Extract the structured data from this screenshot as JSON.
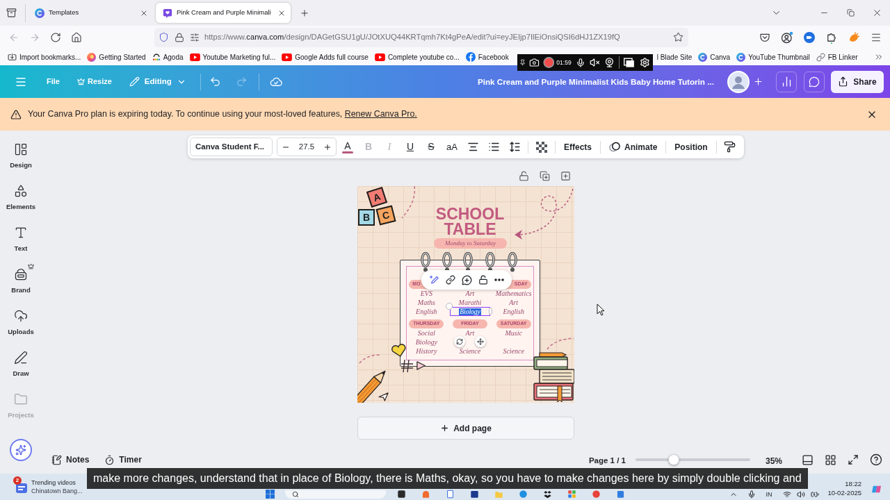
{
  "browser": {
    "tabs": [
      {
        "title": "Templates",
        "kind": "canva",
        "selected": false
      },
      {
        "title": "Pink Cream and Purple Minimali",
        "kind": "design",
        "selected": true
      }
    ],
    "navigation": [
      {
        "kind": "back",
        "disabled": true
      },
      {
        "kind": "forward",
        "disabled": true
      },
      {
        "kind": "reload",
        "disabled": false
      },
      {
        "kind": "home",
        "disabled": false
      }
    ],
    "url": {
      "prefix": "https://www.",
      "domain": "canva.com",
      "path": "/design/DAGetGSU1gU/JOtXUQ44KRTqmh7Kt4gPeA/edit?ui=eyJEIjp7IlEiOnsiQSI6dHJ1ZX19fQ"
    }
  },
  "bookmarks_bar": {
    "items": [
      {
        "label": "Import bookmarks...",
        "kind": "import"
      },
      {
        "label": "Getting Started",
        "kind": "firefox"
      },
      {
        "label": "Agoda",
        "kind": "agoda"
      },
      {
        "label": "Youtube Marketing ful...",
        "kind": "youtube"
      },
      {
        "label": "Google Adds full course",
        "kind": "youtube"
      },
      {
        "label": "Complete youtube co...",
        "kind": "youtube"
      },
      {
        "label": "Facebook",
        "kind": "facebook"
      }
    ],
    "recorder": {
      "time": "01:59"
    },
    "items_after_recorder": [
      {
        "label": "l Blade Site",
        "kind": "plain"
      },
      {
        "label": "Canva",
        "kind": "canva"
      },
      {
        "label": "YouTube Thumbnail",
        "kind": "canva"
      },
      {
        "label": "FB Linker",
        "kind": "link"
      }
    ]
  },
  "editor_header": {
    "menu": [
      {
        "label": "File",
        "kind": "file"
      },
      {
        "label": "Resize",
        "kind": "resize"
      },
      {
        "label": "Editing",
        "kind": "editing"
      }
    ],
    "history": [
      {
        "kind": "undo",
        "disabled": false
      },
      {
        "kind": "redo",
        "disabled": true
      }
    ],
    "title": "Pink Cream and Purple Minimalist Kids Baby Home Tutorin ...",
    "share": "Share"
  },
  "banner": {
    "message": "Your Canva Pro plan is expiring today. To continue using your most-loved features,",
    "link": "Renew Canva Pro."
  },
  "sidebar": {
    "items": [
      {
        "label": "Design",
        "kind": "design",
        "disabled": false
      },
      {
        "label": "Elements",
        "kind": "elements",
        "disabled": false
      },
      {
        "label": "Text",
        "kind": "text",
        "disabled": false
      },
      {
        "label": "Brand",
        "kind": "brand",
        "disabled": false
      },
      {
        "label": "Uploads",
        "kind": "uploads",
        "disabled": false
      },
      {
        "label": "Draw",
        "kind": "draw",
        "disabled": false
      },
      {
        "label": "Projects",
        "kind": "projects",
        "disabled": true
      }
    ]
  },
  "text_toolbar": {
    "font": "Canva Student F...",
    "size": "27.5",
    "controls": [
      {
        "kind": "color",
        "label": "A",
        "color": "#b4587c",
        "disabled": false
      },
      {
        "kind": "bold",
        "label": "B",
        "disabled": true
      },
      {
        "kind": "italic",
        "label": "I",
        "disabled": true
      },
      {
        "kind": "underline",
        "label": "U",
        "disabled": false
      },
      {
        "kind": "strike",
        "label": "S",
        "disabled": false
      },
      {
        "kind": "case",
        "label": "aA",
        "disabled": false
      },
      {
        "kind": "align",
        "disabled": false
      },
      {
        "kind": "list",
        "disabled": false
      },
      {
        "kind": "spacing",
        "disabled": false
      },
      {
        "kind": "transparency",
        "disabled": false
      }
    ],
    "actions": [
      {
        "kind": "effects",
        "label": "Effects"
      },
      {
        "kind": "animate",
        "label": "Animate"
      },
      {
        "kind": "position",
        "label": "Position"
      },
      {
        "kind": "format_painter"
      }
    ]
  },
  "design": {
    "blocks": [
      {
        "letter": "A",
        "color": "#f07c73"
      },
      {
        "letter": "B",
        "color": "#a3d9e6"
      },
      {
        "letter": "C",
        "color": "#f4a45e"
      }
    ],
    "title": "SCHOOL TABLE",
    "subtitle": "Monday to Saturday",
    "rows": [
      {
        "columns": [
          {
            "day": "MO",
            "subjects": [
              {
                "text": "EVS",
                "selected": false
              },
              {
                "text": "Maths",
                "selected": false
              },
              {
                "text": "English",
                "selected": false
              }
            ]
          },
          {
            "subjects": [
              {
                "text": "Art",
                "selected": false
              },
              {
                "text": "Marathi",
                "selected": false
              },
              {
                "text": "Biology",
                "selected": true
              }
            ]
          },
          {
            "day": "SDAY",
            "subjects": [
              {
                "text": "Mathematics",
                "selected": false
              },
              {
                "text": "Art",
                "selected": false
              },
              {
                "text": "English",
                "selected": false
              }
            ]
          }
        ]
      },
      {
        "columns": [
          {
            "day": "THURSDAY",
            "subjects": [
              {
                "text": "Social",
                "selected": false
              },
              {
                "text": "Biology",
                "selected": false
              },
              {
                "text": "History",
                "selected": false
              }
            ]
          },
          {
            "day": "FRIDAY",
            "subjects": [
              {
                "text": "Art",
                "selected": false
              },
              {
                "text": "Science",
                "selected": false
              }
            ]
          },
          {
            "day": "SATURDAY",
            "subjects": [
              {
                "text": "Music",
                "selected": false
              },
              {
                "text": "Science",
                "selected": false
              }
            ]
          }
        ]
      }
    ]
  },
  "add_page": "Add page",
  "footer": {
    "notes": "Notes",
    "timer": "Timer",
    "page": "Page 1 / 1",
    "zoom": {
      "level": 0.333,
      "reading": "35%"
    }
  },
  "taskbar": {
    "widget": {
      "badge": "2",
      "title": "Trending videos",
      "subtitle": "Chinatown Bang..."
    },
    "language": "IN",
    "time": "18:22",
    "date": "10-02-2025"
  },
  "caption": "make more changes, understand that in place of Biology, there is Maths, okay, so you have to make changes here by simply double clicking and"
}
